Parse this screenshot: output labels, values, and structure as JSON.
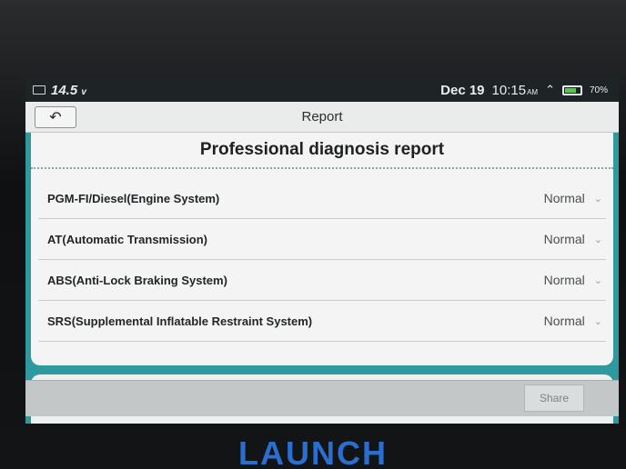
{
  "status_bar": {
    "voltage": "14.5",
    "voltage_unit": "v",
    "date": "Dec 19",
    "time": "10:15",
    "ampm": "AM",
    "battery": "70%",
    "icons": [
      "tool-icon",
      "wifi-icon",
      "battery-icon"
    ]
  },
  "titlebar": {
    "title": "Report",
    "back_icon": "back-arrow-icon"
  },
  "report": {
    "heading": "Professional diagnosis report",
    "systems": [
      {
        "name": "PGM-FI/Diesel(Engine System)",
        "status": "Normal"
      },
      {
        "name": "AT(Automatic Transmission)",
        "status": "Normal"
      },
      {
        "name": "ABS(Anti-Lock Braking System)",
        "status": "Normal"
      },
      {
        "name": "SRS(Supplemental Inflatable Restraint System)",
        "status": "Normal"
      }
    ]
  },
  "bottom": {
    "share_label": "Share"
  },
  "device": {
    "brand": "LAUNCH"
  },
  "colors": {
    "accent": "#2e9aa0",
    "status_bar": "#1e2326",
    "brand": "#2a6fd0"
  }
}
